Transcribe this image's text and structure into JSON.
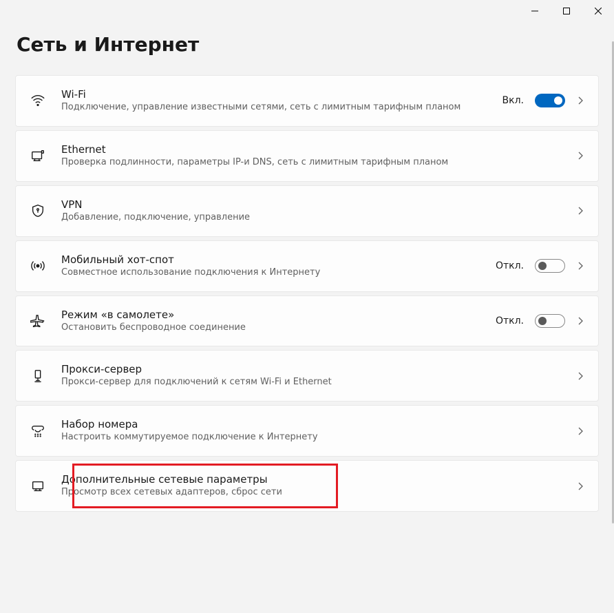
{
  "page_title": "Сеть и Интернет",
  "settings": {
    "wifi": {
      "title": "Wi-Fi",
      "description": "Подключение, управление известными сетями, сеть с лимитным тарифным планом",
      "toggle_label": "Вкл.",
      "toggle_state": "on"
    },
    "ethernet": {
      "title": "Ethernet",
      "description": "Проверка подлинности, параметры IP-и DNS, сеть с лимитным тарифным планом"
    },
    "vpn": {
      "title": "VPN",
      "description": "Добавление, подключение, управление"
    },
    "hotspot": {
      "title": "Мобильный хот-спот",
      "description": "Совместное использование подключения к Интернету",
      "toggle_label": "Откл.",
      "toggle_state": "off"
    },
    "airplane": {
      "title": "Режим «в самолете»",
      "description": "Остановить беспроводное соединение",
      "toggle_label": "Откл.",
      "toggle_state": "off"
    },
    "proxy": {
      "title": "Прокси-сервер",
      "description": "Прокси-сервер для подключений к сетям Wi-Fi и Ethernet"
    },
    "dialup": {
      "title": "Набор номера",
      "description": "Настроить коммутируемое подключение к Интернету"
    },
    "advanced": {
      "title": "Дополнительные сетевые параметры",
      "description": "Просмотр всех сетевых адаптеров, сброс сети"
    }
  }
}
